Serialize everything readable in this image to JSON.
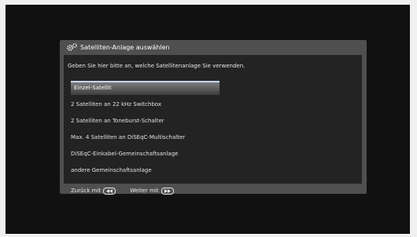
{
  "dialog": {
    "title": "Satelliten-Anlage auswählen",
    "title_icon": "gear-icon",
    "instruction": "Geben Sie hier bitte an, welche Satellitenanlage Sie verwenden.",
    "options": [
      {
        "label": "Einzel-Satellit",
        "selected": true
      },
      {
        "label": "2 Satelliten an 22 kHz Switchbox",
        "selected": false
      },
      {
        "label": "2 Satelliten an Toneburst-Schalter",
        "selected": false
      },
      {
        "label": "Max. 4 Satelliten an DiSEqC-Multischalter",
        "selected": false
      },
      {
        "label": "DiSEqC-Einkabel-Gemeinschaftsanlage",
        "selected": false
      },
      {
        "label": "andere Gemeinschaftsanlage",
        "selected": false
      }
    ],
    "footer": {
      "back_label": "Zurück mit",
      "back_icon": "rewind-icon",
      "next_label": "Weiter mit",
      "next_icon": "fast-forward-icon"
    }
  },
  "colors": {
    "background": "#111111",
    "dialog": "#4f4f4f",
    "panel": "#232323",
    "highlight_line": "#c4d8f2"
  }
}
